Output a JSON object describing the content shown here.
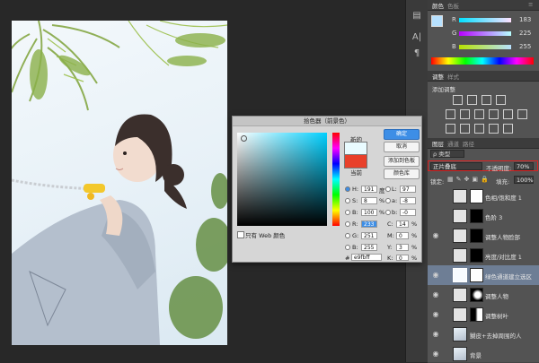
{
  "color_panel": {
    "tabs": [
      "颜色",
      "色板"
    ],
    "r_label": "R",
    "r_value": "183",
    "g_label": "G",
    "g_value": "225",
    "b_label": "B",
    "b_value": "255",
    "fg_color": "#b7e1ff"
  },
  "adjust_panel": {
    "tabs": [
      "调整",
      "样式"
    ],
    "title": "添加调整"
  },
  "layers_panel": {
    "tabs": [
      "图层",
      "通道",
      "路径"
    ],
    "filter_label": "ρ 类型",
    "blend_mode": "正片叠底",
    "opacity_label": "不透明度:",
    "opacity_value": "70%",
    "lock_label": "锁定:",
    "fill_label": "填充:",
    "fill_value": "100%",
    "layers": [
      {
        "name": "色相/饱和度 1"
      },
      {
        "name": "色阶 3"
      },
      {
        "name": "调整人物脸部"
      },
      {
        "name": "亮度/对比度 1"
      },
      {
        "name": "绿色通道建立选区"
      },
      {
        "name": "调整人物"
      },
      {
        "name": "调整树叶"
      },
      {
        "name": "嬲皮+去掉周围的人"
      },
      {
        "name": "背景"
      }
    ]
  },
  "picker": {
    "title": "拾色器（前景色）",
    "ok": "确定",
    "cancel": "取消",
    "add_swatch": "添加到色板",
    "libraries": "颜色库",
    "new_label": "新的",
    "current_label": "当前",
    "web_only": "只有 Web 颜色",
    "h_label": "H:",
    "h_value": "191",
    "h_unit": "度",
    "s_label": "S:",
    "s_value": "8",
    "s_unit": "%",
    "b_label": "B:",
    "b_value": "100",
    "b_unit": "%",
    "r_label": "R:",
    "r_value": "233",
    "g_label": "G:",
    "g_value": "251",
    "bb_label": "B:",
    "bb_value": "255",
    "l_label": "L:",
    "l_value": "97",
    "a_label": "a:",
    "a_value": "-8",
    "b2_label": "b:",
    "b2_value": "-0",
    "c_label": "C:",
    "c_value": "14",
    "c_unit": "%",
    "m_label": "M:",
    "m_value": "0",
    "m_unit": "%",
    "y_label": "Y:",
    "y_value": "3",
    "y_unit": "%",
    "k_label": "K:",
    "k_value": "0",
    "k_unit": "%",
    "hex_label": "#",
    "hex_value": "e9fbff",
    "new_color": "#e9fbff",
    "current_color": "#e8402a"
  }
}
